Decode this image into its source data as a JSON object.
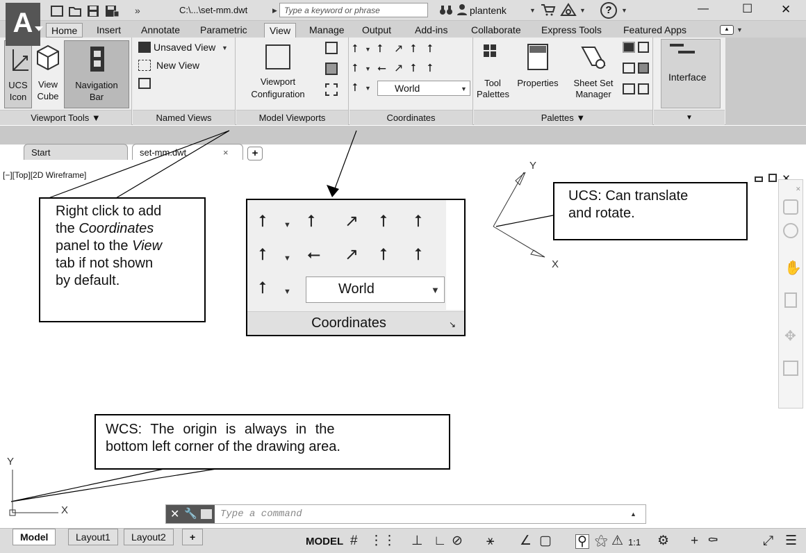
{
  "titlebar": {
    "app_letter": "A",
    "file_path": "C:\\...\\set-mm.dwt",
    "search_placeholder": "Type a keyword or phrase",
    "user": "plantenk",
    "minimize": "—",
    "maximize": "☐",
    "close": "✕",
    "help": "?"
  },
  "tabs": [
    "Home",
    "Insert",
    "Annotate",
    "Parametric",
    "View",
    "Manage",
    "Output",
    "Add-ins",
    "Collaborate",
    "Express Tools",
    "Featured Apps"
  ],
  "selected_tab": "View",
  "ribbon": {
    "viewport_tools": {
      "title": "Viewport Tools ▼",
      "ucs_icon": "UCS\nIcon",
      "view_cube": "View\nCube",
      "navigation_bar": "Navigation\nBar",
      "ucs_icon_l1": "UCS",
      "ucs_icon_l2": "Icon",
      "view_cube_l1": "View",
      "view_cube_l2": "Cube",
      "nav_l1": "Navigation",
      "nav_l2": "Bar"
    },
    "named_views": {
      "title": "Named Views",
      "dropdown": "Unsaved View",
      "new_view": "New View"
    },
    "model_viewports": {
      "title": "Model Viewports",
      "viewport_config_l1": "Viewport",
      "viewport_config_l2": "Configuration"
    },
    "coordinates": {
      "title": "Coordinates",
      "ucs_select": "World"
    },
    "palettes": {
      "title": "Palettes ▼",
      "tool_palettes_l1": "Tool",
      "tool_palettes_l2": "Palettes",
      "properties": "Properties",
      "sheet_set_l1": "Sheet Set",
      "sheet_set_l2": "Manager"
    },
    "interface": {
      "label": "Interface",
      "arrow": "▼"
    }
  },
  "doc_tabs": {
    "start": "Start",
    "file": "set-mm.dwt",
    "close": "×",
    "add": "+"
  },
  "viewport_label": "[−][Top][2D Wireframe]",
  "callouts": {
    "right_click": {
      "l1": "Right click to add",
      "l2a": "the ",
      "l2b": "Coordinates",
      "l3a": "panel to the ",
      "l3b": "View",
      "l4": "tab if not shown",
      "l5": "by default."
    },
    "ucs": {
      "l1": "UCS:  Can translate",
      "l2": "and rotate."
    },
    "wcs": {
      "l1": "WCS:  The origin is always in the",
      "l2": "bottom left corner of the drawing area."
    }
  },
  "coord_panel_zoom": {
    "title": "Coordinates",
    "ucs_select": "World"
  },
  "axes": {
    "x": "X",
    "y": "Y"
  },
  "command_line": {
    "placeholder": "Type a command"
  },
  "layout_tabs": [
    "Model",
    "Layout1",
    "Layout2"
  ],
  "layout_add": "+",
  "status_bar": {
    "model": "MODEL",
    "scale": "1:1"
  }
}
